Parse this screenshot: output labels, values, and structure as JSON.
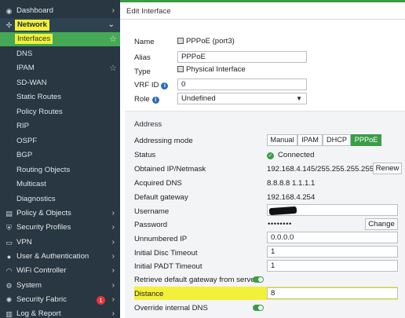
{
  "sidebar": {
    "items": [
      {
        "icon": "dashboard-icon",
        "glyph": "◉",
        "label": "Dashboard",
        "chevron": "›"
      },
      {
        "icon": "network-icon",
        "glyph": "✣",
        "label": "Network",
        "chevron": "⌄"
      },
      {
        "label": "Interfaces",
        "star": "☆"
      },
      {
        "label": "DNS"
      },
      {
        "label": "IPAM",
        "star": "☆"
      },
      {
        "label": "SD-WAN"
      },
      {
        "label": "Static Routes"
      },
      {
        "label": "Policy Routes"
      },
      {
        "label": "RIP"
      },
      {
        "label": "OSPF"
      },
      {
        "label": "BGP"
      },
      {
        "label": "Routing Objects"
      },
      {
        "label": "Multicast"
      },
      {
        "label": "Diagnostics"
      },
      {
        "icon": "policy-icon",
        "glyph": "▤",
        "label": "Policy & Objects",
        "chevron": "›"
      },
      {
        "icon": "security-profiles-icon",
        "glyph": "⛨",
        "label": "Security Profiles",
        "chevron": "›"
      },
      {
        "icon": "vpn-icon",
        "glyph": "▭",
        "label": "VPN",
        "chevron": "›"
      },
      {
        "icon": "user-icon",
        "glyph": "●",
        "label": "User & Authentication",
        "chevron": "›"
      },
      {
        "icon": "wifi-icon",
        "glyph": "◠",
        "label": "WiFi Controller",
        "chevron": "›"
      },
      {
        "icon": "gear-icon",
        "glyph": "⚙",
        "label": "System",
        "chevron": "›"
      },
      {
        "icon": "security-fabric-icon",
        "glyph": "✺",
        "label": "Security Fabric",
        "chevron": "›",
        "badge": "1"
      },
      {
        "icon": "log-icon",
        "glyph": "▥",
        "label": "Log & Report",
        "chevron": "›"
      }
    ]
  },
  "header": {
    "title": "Edit Interface"
  },
  "form": {
    "name_label": "Name",
    "name_value": "PPPoE (port3)",
    "alias_label": "Alias",
    "alias_value": "PPPoE",
    "type_label": "Type",
    "type_value": "Physical Interface",
    "vrf_label": "VRF ID",
    "vrf_value": "0",
    "role_label": "Role",
    "role_value": "Undefined",
    "info_glyph": "i"
  },
  "address": {
    "section_title": "Address",
    "mode_label": "Addressing mode",
    "modes": [
      "Manual",
      "IPAM",
      "DHCP",
      "PPPoE"
    ],
    "active_mode": "PPPoE",
    "status_label": "Status",
    "status_value": "Connected",
    "status_glyph": "✓",
    "ip_label": "Obtained IP/Netmask",
    "ip_value": "192.168.4.145/255.255.255.255",
    "renew_label": "Renew",
    "dns_label": "Acquired DNS",
    "dns_value": "8.8.8.8  1.1.1.1",
    "gw_label": "Default gateway",
    "gw_value": "192.168.4.254",
    "username_label": "Username",
    "password_label": "Password",
    "password_value": "••••••••",
    "change_label": "Change",
    "unnumbered_label": "Unnumbered IP",
    "unnumbered_value": "0.0.0.0",
    "disc_label": "Initial Disc Timeout",
    "disc_value": "1",
    "padt_label": "Initial PADT Timeout",
    "padt_value": "1",
    "retrieve_gw_label": "Retrieve default gateway from server",
    "retrieve_gw_enabled": true,
    "distance_label": "Distance",
    "distance_value": "8",
    "override_dns_label": "Override internal DNS",
    "override_dns_enabled": true
  },
  "colors": {
    "accent": "#3a9d47",
    "highlight": "#f2f03a",
    "sidebar_bg": "#283742",
    "badge": "#e0383e"
  }
}
